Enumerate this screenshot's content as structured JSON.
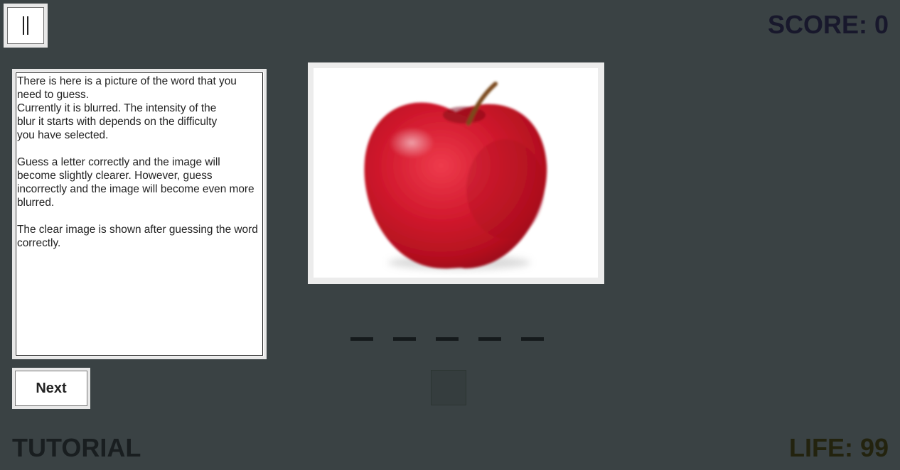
{
  "hud": {
    "score": "SCORE: 0",
    "life": "LIFE: 99",
    "mode": "TUTORIAL"
  },
  "tutorial": {
    "paragraphs": [
      "There is here is a picture of the word that you\nneed to guess.\nCurrently it is blurred. The intensity of the\nblur it starts with depends on the difficulty\nyou have selected.",
      "Guess a letter correctly and the image will\nbecome slightly clearer. However, guess\nincorrectly and the image will become even more\nblurred.",
      "The clear image is shown after guessing the word\ncorrectly."
    ],
    "next_label": "Next"
  },
  "puzzle": {
    "image_icon": "blurred-apple-picture",
    "letter_count": 5,
    "guessed_letters": [
      "",
      "",
      "",
      "",
      ""
    ]
  },
  "colors": {
    "background": "#3a4244",
    "apple_red": "#d01a2c",
    "score_text": "#18182c",
    "life_text": "#23230e"
  }
}
